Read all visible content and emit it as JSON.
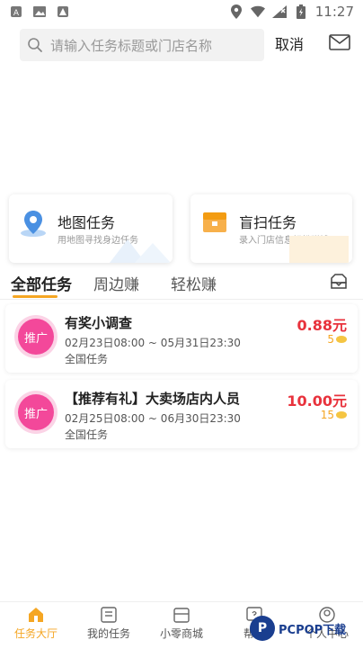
{
  "status_bar": {
    "time": "11:27"
  },
  "search": {
    "placeholder": "请输入任务标题或门店名称",
    "cancel_label": "取消"
  },
  "feature_cards": [
    {
      "title": "地图任务",
      "subtitle": "用地图寻找身边任务",
      "icon": "map-pin-icon"
    },
    {
      "title": "盲扫任务",
      "subtitle": "录入门店信息轻松赚钱",
      "icon": "scan-box-icon"
    }
  ],
  "tabs": [
    {
      "label": "全部任务",
      "active": true
    },
    {
      "label": "周边赚",
      "active": false
    },
    {
      "label": "轻松赚",
      "active": false
    }
  ],
  "tasks": [
    {
      "badge": "推广",
      "title": "有奖小调查",
      "time": "02月23日08:00 ~ 05月31日23:30",
      "scope": "全国任务",
      "price": "0.88元",
      "coins": "5"
    },
    {
      "badge": "推广",
      "title": "【推荐有礼】大卖场店内人员",
      "time": "02月25日08:00 ~ 06月30日23:30",
      "scope": "全国任务",
      "price": "10.00元",
      "coins": "15"
    }
  ],
  "bottom_nav": [
    {
      "label": "任务大厅",
      "icon": "home-icon",
      "active": true
    },
    {
      "label": "我的任务",
      "icon": "list-icon",
      "active": false
    },
    {
      "label": "小零商城",
      "icon": "shop-icon",
      "active": false
    },
    {
      "label": "帮助",
      "icon": "help-icon",
      "active": false
    },
    {
      "label": "个人中心",
      "icon": "user-icon",
      "active": false
    }
  ],
  "watermark": {
    "text": "PCPOP下载",
    "mark": "P"
  },
  "colors": {
    "accent": "#f5a623",
    "price": "#e8323c",
    "badge": "#f3489a"
  }
}
